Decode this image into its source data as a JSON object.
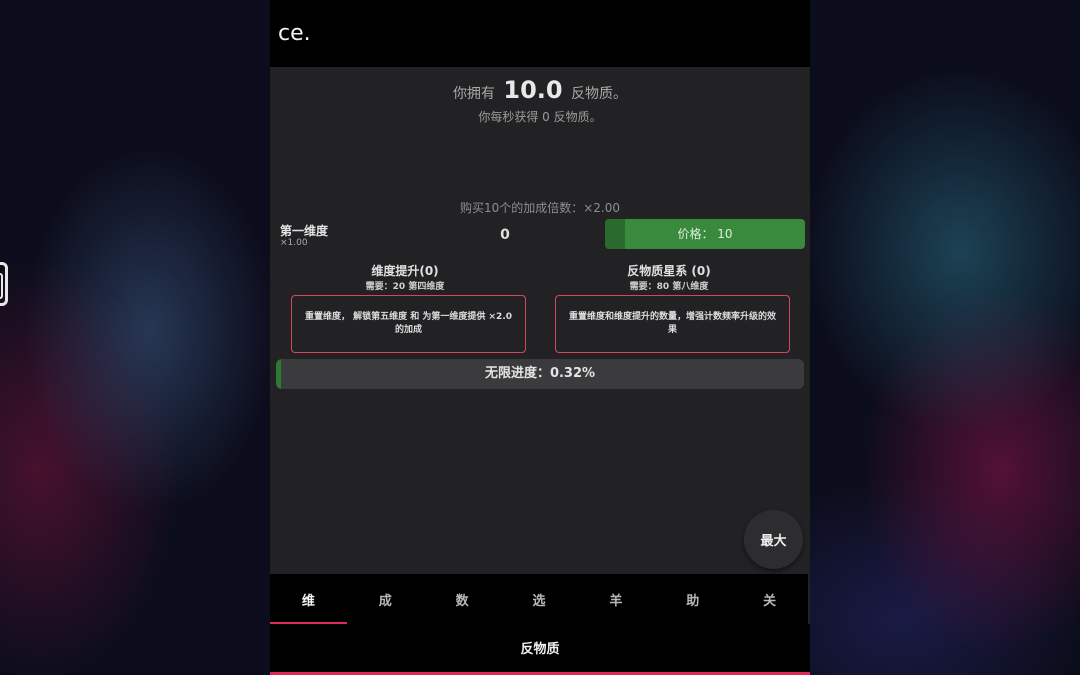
{
  "header": {
    "truncated_text": "ce."
  },
  "antimatter": {
    "prefix": "你拥有",
    "amount": "10.0",
    "suffix": "反物质。",
    "rate_text": "你每秒获得 0 反物质。"
  },
  "buy10_text": "购买10个的加成倍数：×2.00",
  "dimension": {
    "name": "第一维度",
    "multiplier": "×1.00",
    "amount": "0",
    "cost_label": "价格： 10",
    "progress_fraction": 0.1
  },
  "dimboost": {
    "title": "维度提升(0)",
    "requirement": "需要：20 第四维度",
    "description": "重置维度， 解锁第五维度 和 为第一维度提供 ×2.0 的加成"
  },
  "galaxy": {
    "title": "反物质星系 (0)",
    "requirement": "需要：80 第八维度",
    "description": "重置维度和维度提升的数量，增强计数频率升级的效果"
  },
  "infinity_progress": {
    "label": "无限进度：0.32%",
    "percent": 0.32
  },
  "max_button": {
    "label": "最大"
  },
  "tabs": [
    {
      "label": "维"
    },
    {
      "label": "成"
    },
    {
      "label": "数"
    },
    {
      "label": "选"
    },
    {
      "label": "羊"
    },
    {
      "label": "助"
    },
    {
      "label": "关"
    }
  ],
  "subtab": {
    "label": "反物质"
  },
  "colors": {
    "accent": "#e0285a",
    "buy_green": "#3a8a3e",
    "reset_border": "#d6465e"
  }
}
